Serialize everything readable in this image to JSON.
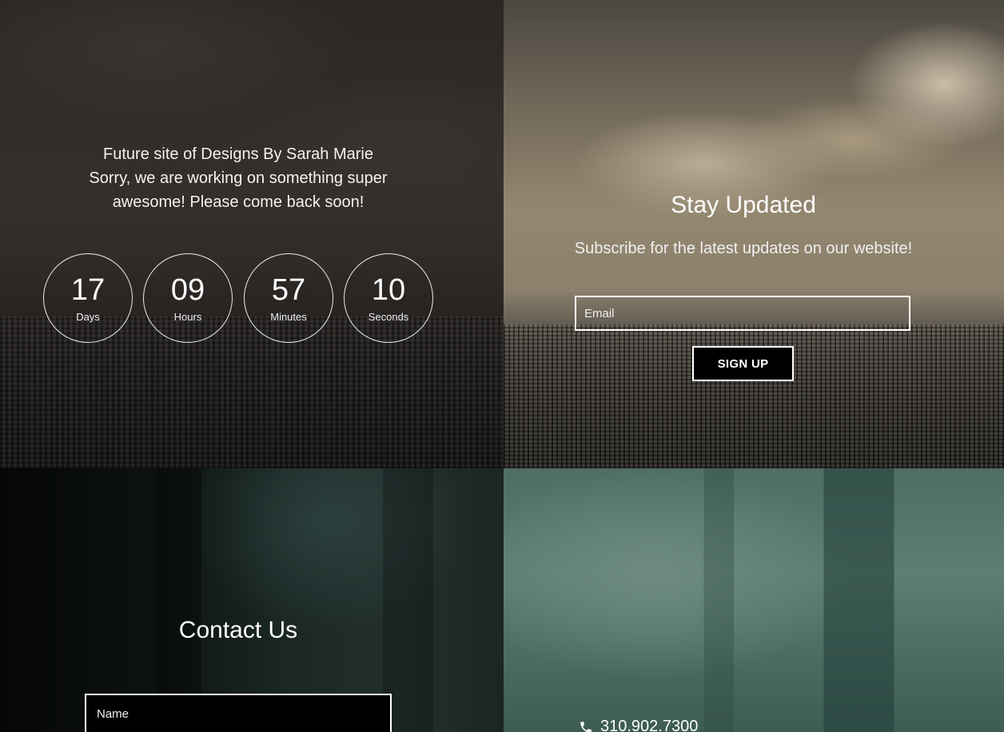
{
  "intro": {
    "line1": "Future site of Designs By Sarah Marie",
    "line2": "Sorry, we are working on something super",
    "line3": "awesome! Please come back soon!"
  },
  "countdown": [
    {
      "value": "17",
      "label": "Days"
    },
    {
      "value": "09",
      "label": "Hours"
    },
    {
      "value": "57",
      "label": "Minutes"
    },
    {
      "value": "10",
      "label": "Seconds"
    }
  ],
  "subscribe": {
    "title": "Stay Updated",
    "subtitle": "Subscribe for the latest updates on our website!",
    "email_placeholder": "Email",
    "button_label": "SIGN UP"
  },
  "contact": {
    "title": "Contact Us",
    "name_placeholder": "Name",
    "phone": "310.902.7300",
    "phone_icon": "phone-icon"
  }
}
